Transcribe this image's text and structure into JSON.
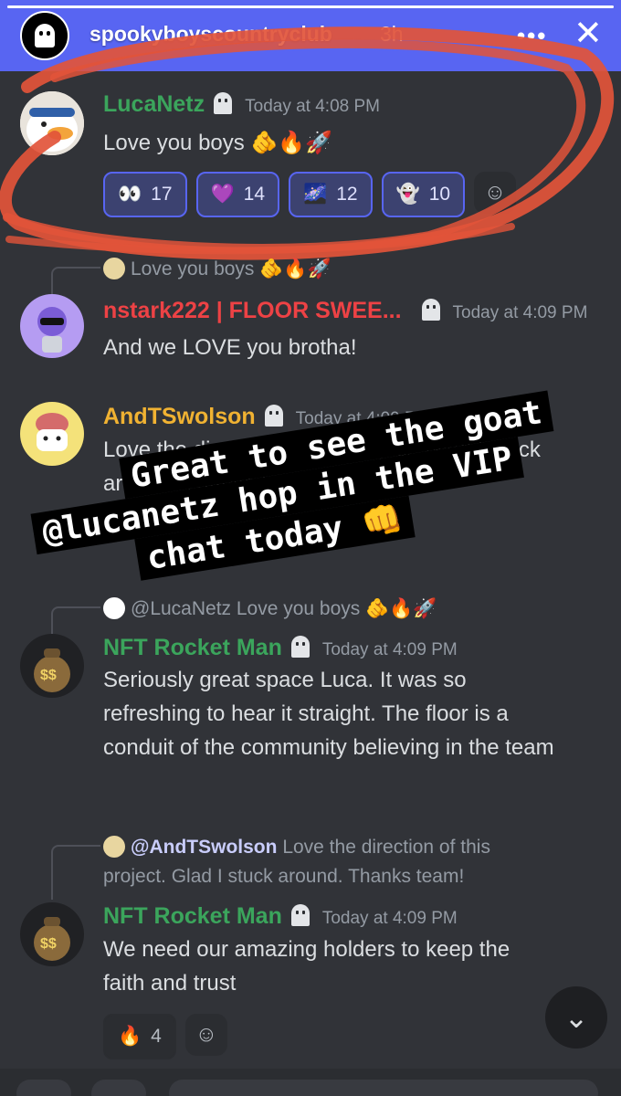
{
  "story": {
    "account": "spookyboyscountryclub",
    "age": "3h",
    "more_label": "•••",
    "close_label": "✕"
  },
  "colors": {
    "brand": "#5865f2",
    "scribble": "#e2543a",
    "green_name": "#3ba55c",
    "red_name": "#ed4245",
    "yellow_name": "#f0b232"
  },
  "messages": [
    {
      "author": "LucaNetz",
      "timestamp": "Today at 4:08 PM",
      "text": "Love you boys 🫵🔥🚀",
      "reactions": [
        {
          "emoji": "👀",
          "count": "17"
        },
        {
          "emoji": "💜",
          "count": "14"
        },
        {
          "emoji": "🌌",
          "count": "12"
        },
        {
          "emoji": "👻",
          "count": "10"
        }
      ],
      "add_reaction_icon": "☺"
    },
    {
      "reply_preview": "Love you boys 🫵🔥🚀",
      "author": "nstark222 | FLOOR SWEE...",
      "timestamp": "Today at 4:09 PM",
      "text": "And we LOVE you brotha!"
    },
    {
      "author": "AndTSwolson",
      "timestamp": "Today at 4:09 PM",
      "text": "Love the direction of this project. Glad I stuck around. Thanks team!"
    },
    {
      "reply_preview": "@LucaNetz Love you boys 🫵🔥🚀",
      "author": "NFT Rocket Man",
      "timestamp": "Today at 4:09 PM",
      "text": "Seriously great space Luca. It was so refreshing to hear it straight. The floor is a conduit of the community believing in the team"
    },
    {
      "reply_mention": "@AndTSwolson",
      "reply_preview": "Love the direction of this project. Glad I stuck around. Thanks team!",
      "author": "NFT Rocket Man",
      "timestamp": "Today at 4:09 PM",
      "text": "We need our amazing holders to keep the faith and trust",
      "reactions": [
        {
          "emoji": "🔥",
          "count": "4"
        }
      ]
    }
  ],
  "sticker": {
    "line1": "Great to see the goat",
    "line2": "@lucanetz hop in the VIP",
    "line3": "chat today 👊"
  },
  "scroll_icon": "⌄"
}
